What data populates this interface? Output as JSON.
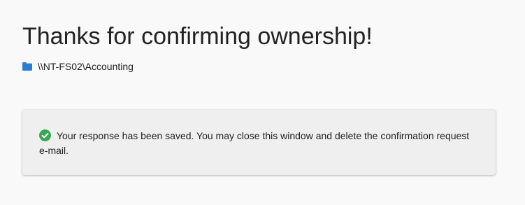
{
  "page": {
    "title": "Thanks for confirming ownership!",
    "share_path": "\\\\NT-FS02\\Accounting",
    "folder_icon": "folder-icon",
    "accent_color": "#2b7cd3"
  },
  "notice": {
    "icon": "check-circle-icon",
    "icon_color": "#3aa757",
    "message": "Your response has been saved. You may close this window and delete the confirmation request e-mail."
  }
}
